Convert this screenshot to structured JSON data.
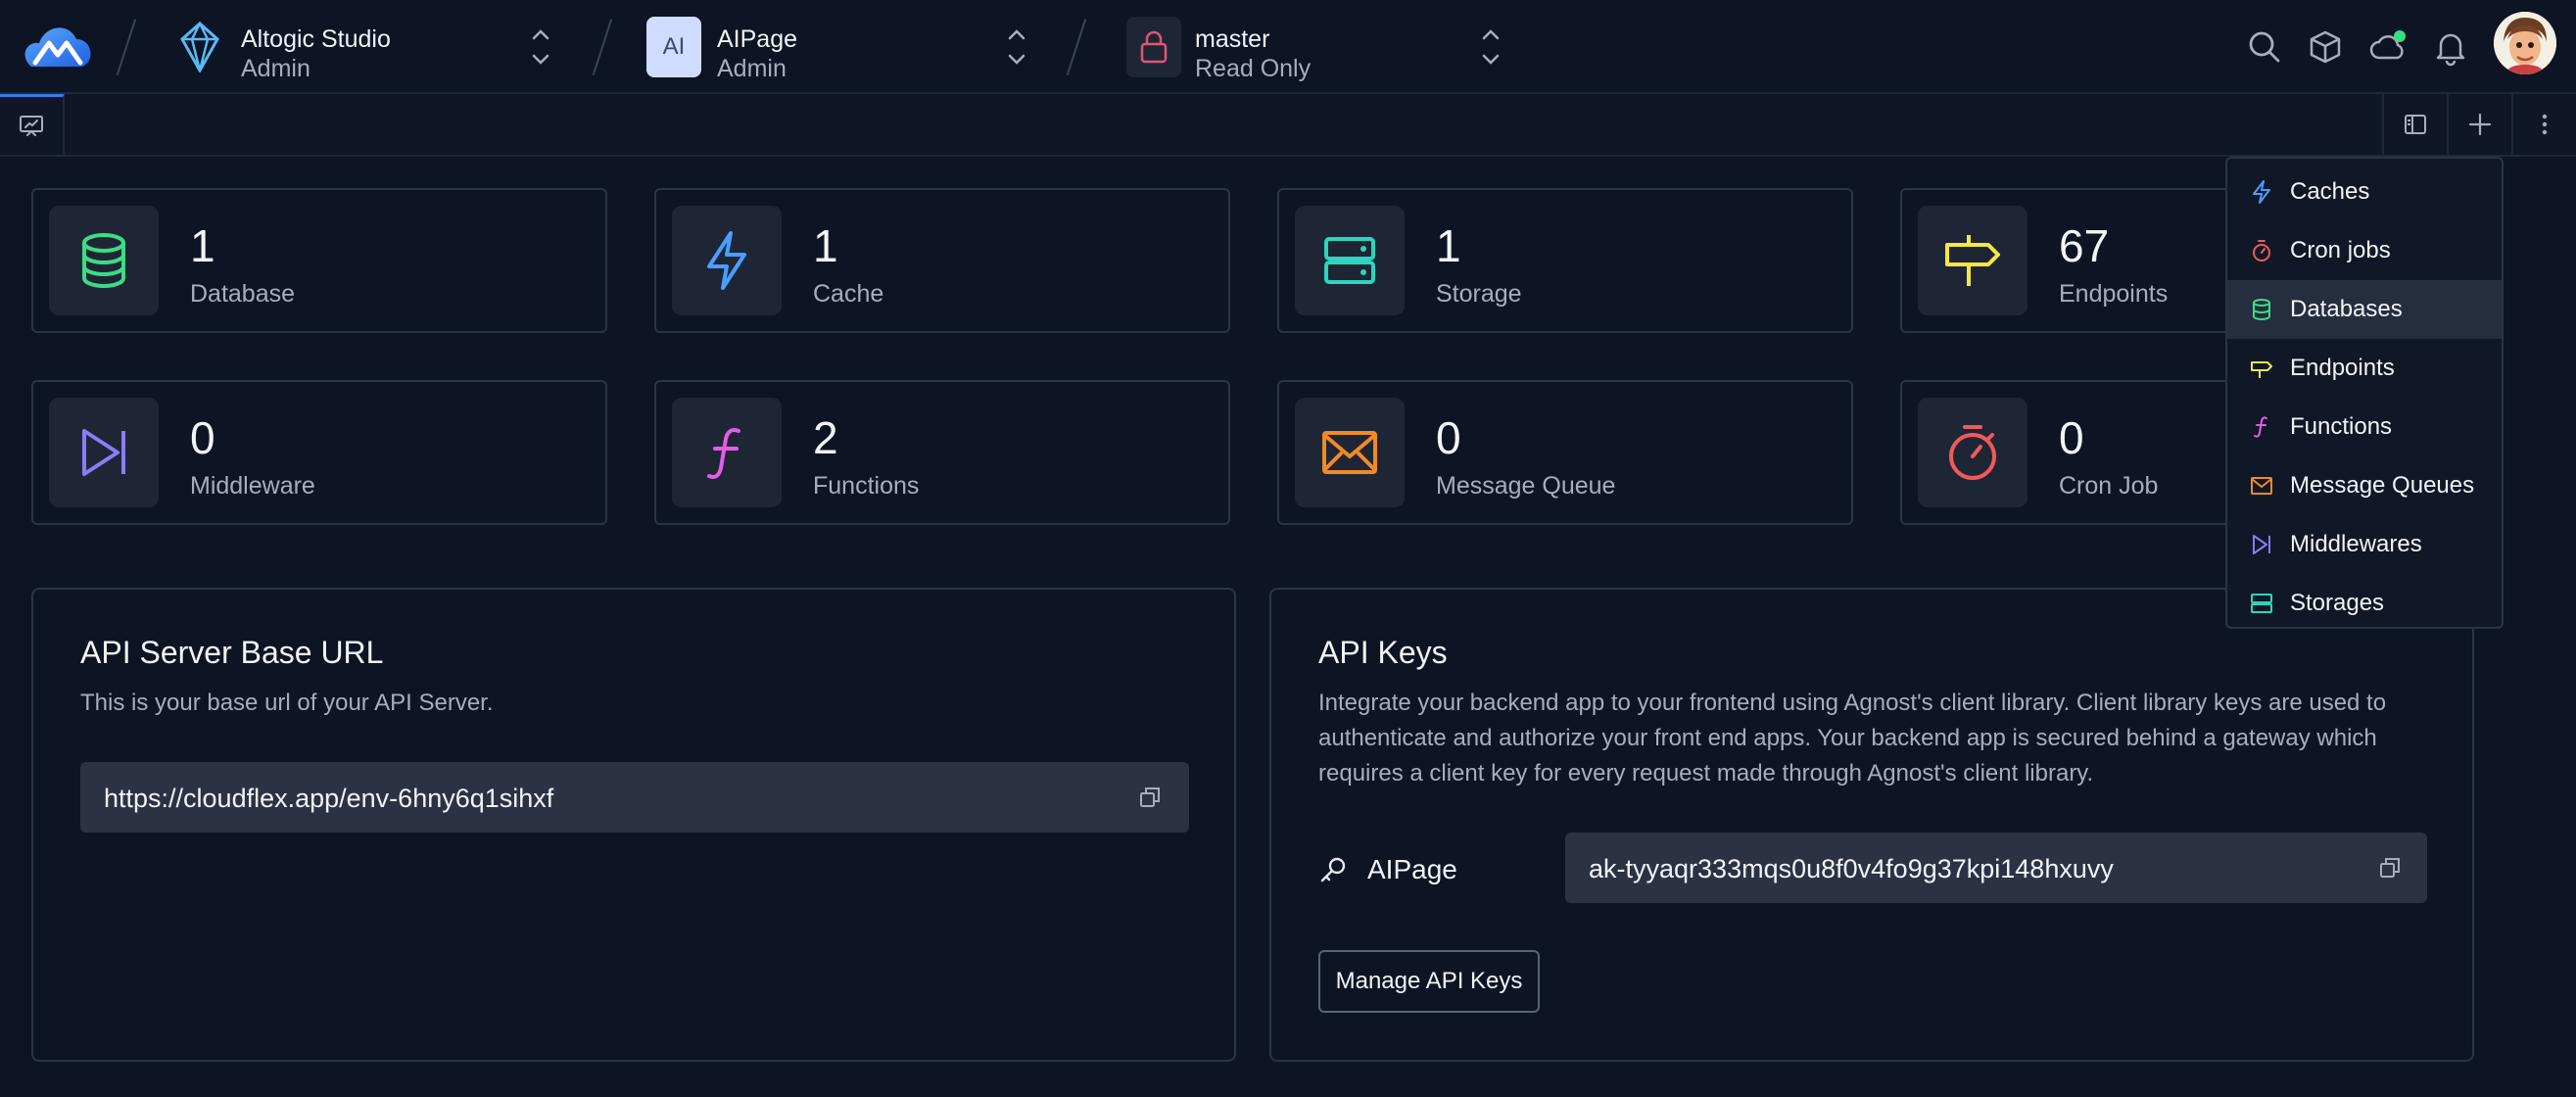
{
  "header": {
    "org": {
      "name": "Altogic Studio",
      "role": "Admin"
    },
    "app": {
      "avatar_text": "AI",
      "name": "AIPage",
      "role": "Admin"
    },
    "env": {
      "name": "master",
      "access": "Read Only"
    }
  },
  "tabs": {
    "home_icon": "presentation-chart-icon"
  },
  "stats": [
    {
      "value": "1",
      "label": "Database",
      "icon": "database-icon",
      "color": "#3ddc84"
    },
    {
      "value": "1",
      "label": "Cache",
      "icon": "lightning-icon",
      "color": "#4a9eff"
    },
    {
      "value": "1",
      "label": "Storage",
      "icon": "storage-icon",
      "color": "#2dd4bf"
    },
    {
      "value": "67",
      "label": "Endpoints",
      "icon": "signpost-icon",
      "color": "#f5e642"
    },
    {
      "value": "0",
      "label": "Middleware",
      "icon": "skip-icon",
      "color": "#8b7cf6"
    },
    {
      "value": "2",
      "label": "Functions",
      "icon": "function-icon",
      "color": "#e45ce8"
    },
    {
      "value": "0",
      "label": "Message Queue",
      "icon": "envelope-icon",
      "color": "#f08a24"
    },
    {
      "value": "0",
      "label": "Cron Job",
      "icon": "timer-icon",
      "color": "#f05a5a"
    }
  ],
  "api_server": {
    "title": "API Server Base URL",
    "description": "This is your base url of your API Server.",
    "url": "https://cloudflex.app/env-6hny6q1sihxf"
  },
  "api_keys": {
    "title": "API Keys",
    "description_lines": [
      "Integrate your backend app to your frontend using Agnost's client library. Client library keys are used to",
      "authenticate and authorize your front end apps. Your backend app is secured behind a gateway which",
      "requires a client key for every request made through Agnost's client library."
    ],
    "key_name": "AIPage",
    "key_value": "ak-tyyaqr333mqs0u8f0v4fo9g37kpi148hxuvy",
    "manage_label": "Manage API Keys"
  },
  "dropdown": {
    "items": [
      {
        "label": "Caches",
        "icon": "lightning-icon",
        "color": "#4a9eff"
      },
      {
        "label": "Cron jobs",
        "icon": "timer-icon",
        "color": "#f05a5a"
      },
      {
        "label": "Databases",
        "icon": "database-icon",
        "color": "#3ddc84"
      },
      {
        "label": "Endpoints",
        "icon": "signpost-icon",
        "color": "#f5e642"
      },
      {
        "label": "Functions",
        "icon": "function-icon",
        "color": "#e45ce8"
      },
      {
        "label": "Message Queues",
        "icon": "envelope-icon",
        "color": "#f08a24"
      },
      {
        "label": "Middlewares",
        "icon": "skip-icon",
        "color": "#8b7cf6"
      },
      {
        "label": "Storages",
        "icon": "storage-icon",
        "color": "#2dd4bf"
      }
    ],
    "active_item": "Databases"
  }
}
